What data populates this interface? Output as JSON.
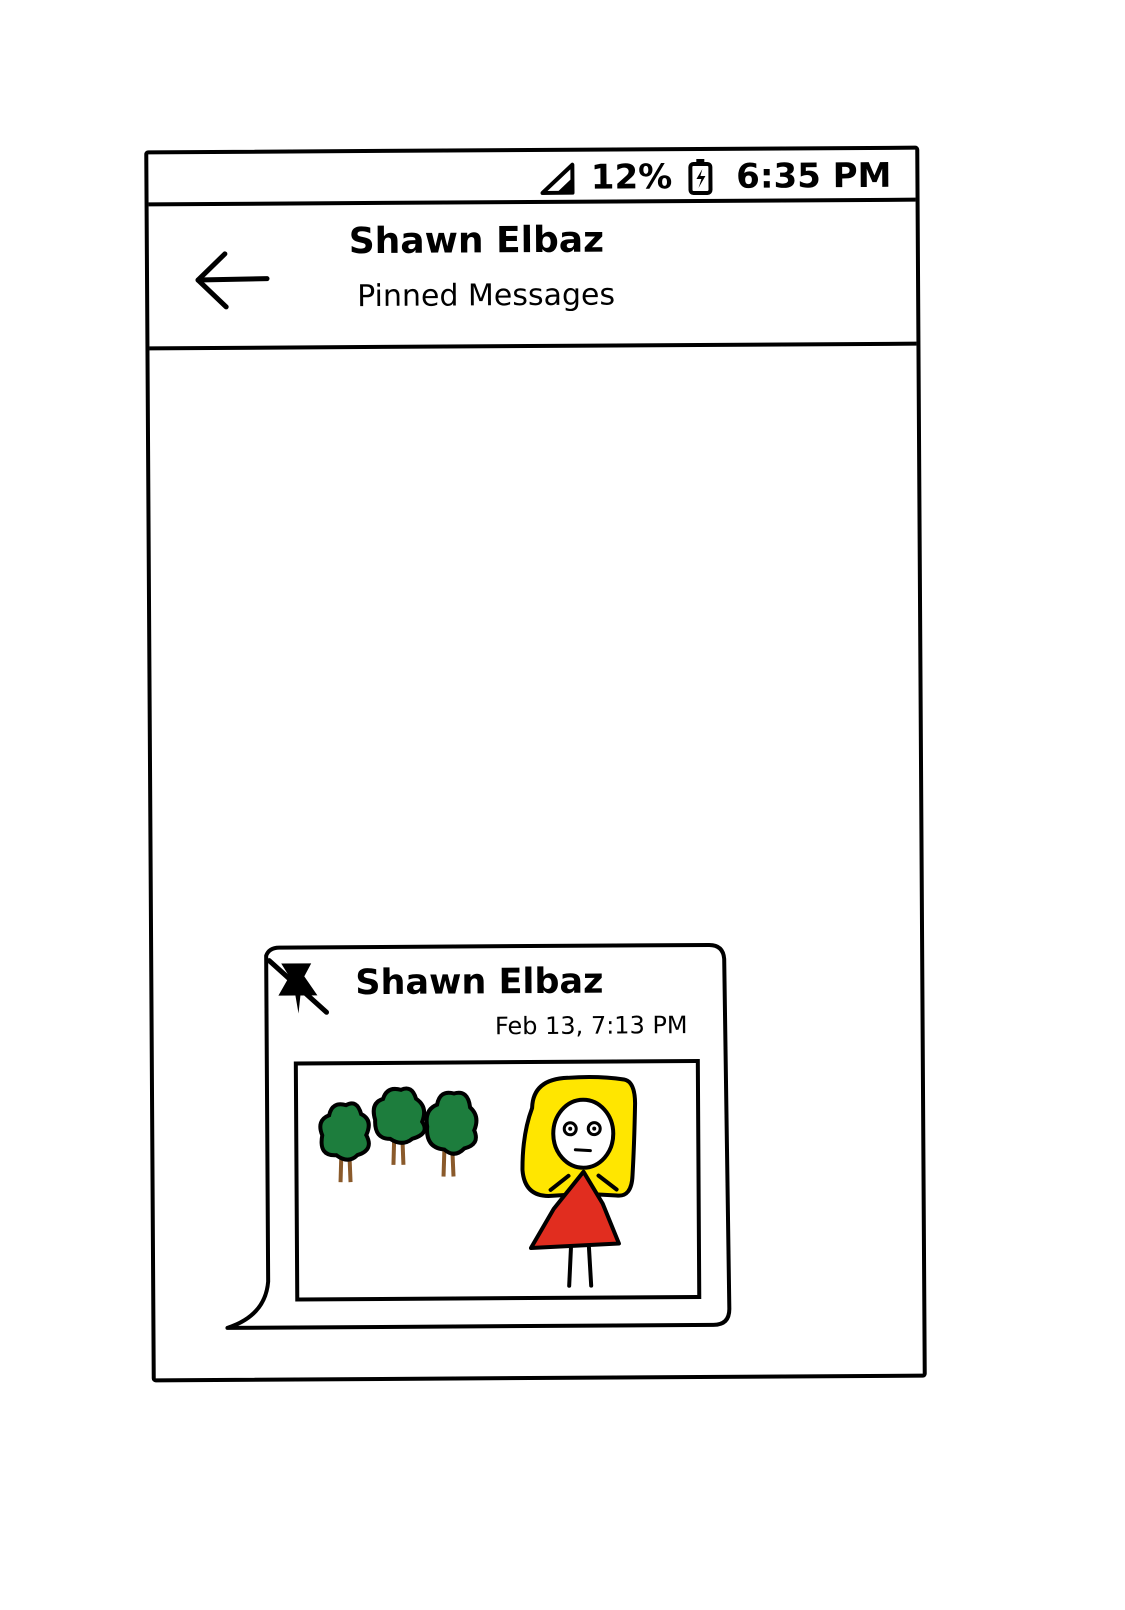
{
  "status_bar": {
    "signal_icon": "signal-icon",
    "battery_percent": "12%",
    "battery_icon": "battery-charging-icon",
    "time": "6:35 PM"
  },
  "header": {
    "back_icon": "arrow-left-icon",
    "title": "Shawn Elbaz",
    "subtitle": "Pinned Messages"
  },
  "pinned_message": {
    "unpin_icon": "unpin-icon",
    "sender": "Shawn Elbaz",
    "timestamp": "Feb 13, 7:13 PM",
    "image_description_icon": "drawing-image-icon"
  },
  "colors": {
    "outline": "#000000",
    "tree_green": "#1d7d3d",
    "tree_trunk": "#8a5a2b",
    "hair_yellow": "#ffe600",
    "dress_red": "#e12d1f"
  }
}
